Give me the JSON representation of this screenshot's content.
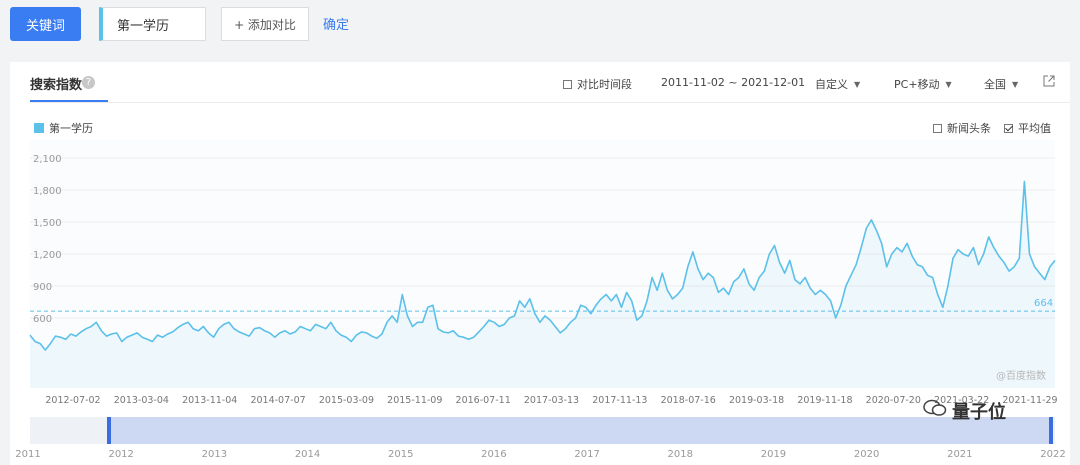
{
  "toolbar": {
    "keyword_button": "关键词",
    "keyword_value": "第一学历",
    "add_compare": "+ 添加对比",
    "confirm": "确定"
  },
  "card": {
    "title": "搜索指数",
    "compare_period": "对比时间段",
    "date_range": "2011-11-02 ~ 2021-12-01",
    "custom": "自定义",
    "platform": "PC+移动",
    "region": "全国",
    "news": "新闻头条",
    "average": "平均值",
    "watermark": "@百度指数"
  },
  "brand_watermark": "量子位",
  "colors": {
    "primary": "#3a7cf2",
    "series": "#5bc0ea"
  },
  "chart_data": {
    "type": "area",
    "series": [
      {
        "name": "第一学历",
        "values": [
          440,
          380,
          360,
          300,
          360,
          430,
          420,
          400,
          450,
          430,
          470,
          500,
          520,
          560,
          480,
          430,
          450,
          460,
          380,
          420,
          440,
          460,
          420,
          400,
          380,
          440,
          420,
          450,
          470,
          510,
          540,
          560,
          500,
          480,
          520,
          460,
          420,
          500,
          540,
          560,
          500,
          470,
          450,
          430,
          500,
          510,
          480,
          460,
          420,
          460,
          480,
          450,
          470,
          520,
          500,
          480,
          540,
          520,
          500,
          560,
          480,
          440,
          420,
          380,
          440,
          470,
          460,
          430,
          410,
          450,
          560,
          620,
          560,
          820,
          620,
          520,
          560,
          560,
          700,
          720,
          500,
          470,
          460,
          480,
          430,
          420,
          400,
          420,
          470,
          520,
          580,
          560,
          520,
          540,
          600,
          620,
          760,
          700,
          780,
          640,
          560,
          620,
          580,
          520,
          460,
          500,
          560,
          600,
          720,
          700,
          640,
          720,
          780,
          820,
          760,
          820,
          700,
          840,
          760,
          580,
          620,
          760,
          980,
          860,
          1020,
          860,
          780,
          820,
          880,
          1080,
          1220,
          1060,
          960,
          1020,
          980,
          840,
          880,
          820,
          940,
          980,
          1060,
          920,
          860,
          980,
          1040,
          1200,
          1280,
          1120,
          1020,
          1140,
          960,
          920,
          980,
          880,
          820,
          860,
          820,
          760,
          600,
          720,
          900,
          1000,
          1100,
          1260,
          1440,
          1520,
          1420,
          1300,
          1080,
          1200,
          1260,
          1220,
          1300,
          1180,
          1100,
          1080,
          1000,
          980,
          820,
          700,
          900,
          1160,
          1240,
          1200,
          1180,
          1260,
          1100,
          1200,
          1360,
          1260,
          1180,
          1120,
          1040,
          1080,
          1160,
          1880,
          1200,
          1080,
          1020,
          960,
          1080,
          1140
        ],
        "x_start": "2011-11-02",
        "x_end": "2021-12-01"
      }
    ],
    "y_ticks": [
      "2,100",
      "1,800",
      "1,500",
      "1,200",
      "900",
      "600"
    ],
    "ylim": [
      300,
      2100
    ],
    "average": 664,
    "average_label": "664",
    "x_tick_labels": [
      "2012-07-02",
      "2013-03-04",
      "2013-11-04",
      "2014-07-07",
      "2015-03-09",
      "2015-11-09",
      "2016-07-11",
      "2017-03-13",
      "2017-11-13",
      "2018-07-16",
      "2019-03-18",
      "2019-11-18",
      "2020-07-20",
      "2021-03-22",
      "2021-11-29"
    ],
    "year_labels": [
      "2011",
      "2012",
      "2013",
      "2014",
      "2015",
      "2016",
      "2017",
      "2018",
      "2019",
      "2020",
      "2021",
      "2022"
    ],
    "grid": true
  }
}
